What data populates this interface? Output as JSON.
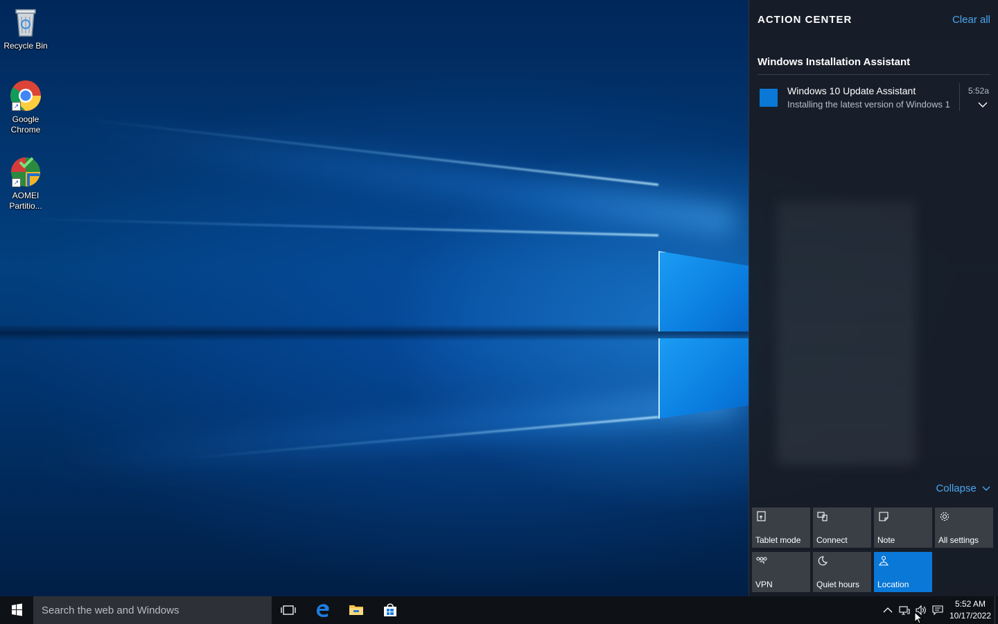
{
  "desktop": {
    "icons": [
      {
        "label": "Recycle Bin",
        "icon": "recycle-bin-icon"
      },
      {
        "label": "Google Chrome",
        "icon": "chrome-icon"
      },
      {
        "label": "AOMEI Partitio...",
        "icon": "aomei-partition-icon"
      }
    ]
  },
  "action_center": {
    "title": "ACTION CENTER",
    "clear_all": "Clear all",
    "group_title": "Windows Installation Assistant",
    "notification": {
      "title": "Windows 10 Update Assistant",
      "body": "Installing the latest version of Windows 1",
      "time": "5:52a",
      "icon_color": "#0a78d7"
    },
    "collapse": "Collapse",
    "quick_actions": [
      {
        "label": "Tablet mode",
        "icon": "tablet-mode-icon",
        "active": false
      },
      {
        "label": "Connect",
        "icon": "connect-icon",
        "active": false
      },
      {
        "label": "Note",
        "icon": "note-icon",
        "active": false
      },
      {
        "label": "All settings",
        "icon": "settings-icon",
        "active": false
      },
      {
        "label": "VPN",
        "icon": "vpn-icon",
        "active": false
      },
      {
        "label": "Quiet hours",
        "icon": "moon-icon",
        "active": false
      },
      {
        "label": "Location",
        "icon": "location-icon",
        "active": true
      }
    ],
    "accent_color": "#0a78d7",
    "link_color": "#4aa6f0"
  },
  "taskbar": {
    "search_placeholder": "Search the web and Windows",
    "pinned": [
      "task-view-icon",
      "edge-icon",
      "file-explorer-icon",
      "store-icon"
    ],
    "tray": [
      "chevron-up-icon",
      "network-icon",
      "volume-icon",
      "action-center-icon"
    ],
    "time": "5:52 AM",
    "date": "10/17/2022"
  }
}
